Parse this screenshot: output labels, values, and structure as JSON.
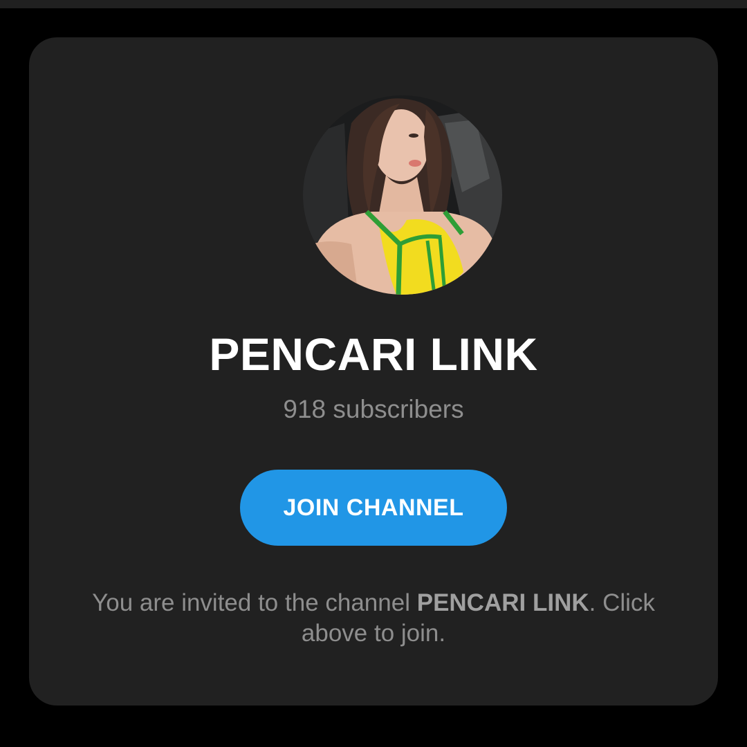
{
  "channel": {
    "name": "PENCARI LINK",
    "subscribers": "918 subscribers",
    "avatar": "profile-photo"
  },
  "join_button": {
    "label": "JOIN CHANNEL"
  },
  "invite": {
    "prefix": "You are invited to the channel ",
    "channel_name": "PENCARI LINK",
    "suffix": ". Click above to join."
  },
  "colors": {
    "page_background": "#000000",
    "card_background": "#212121",
    "button": "#2196e6",
    "title": "#ffffff",
    "muted_text": "#8e8e8e"
  }
}
